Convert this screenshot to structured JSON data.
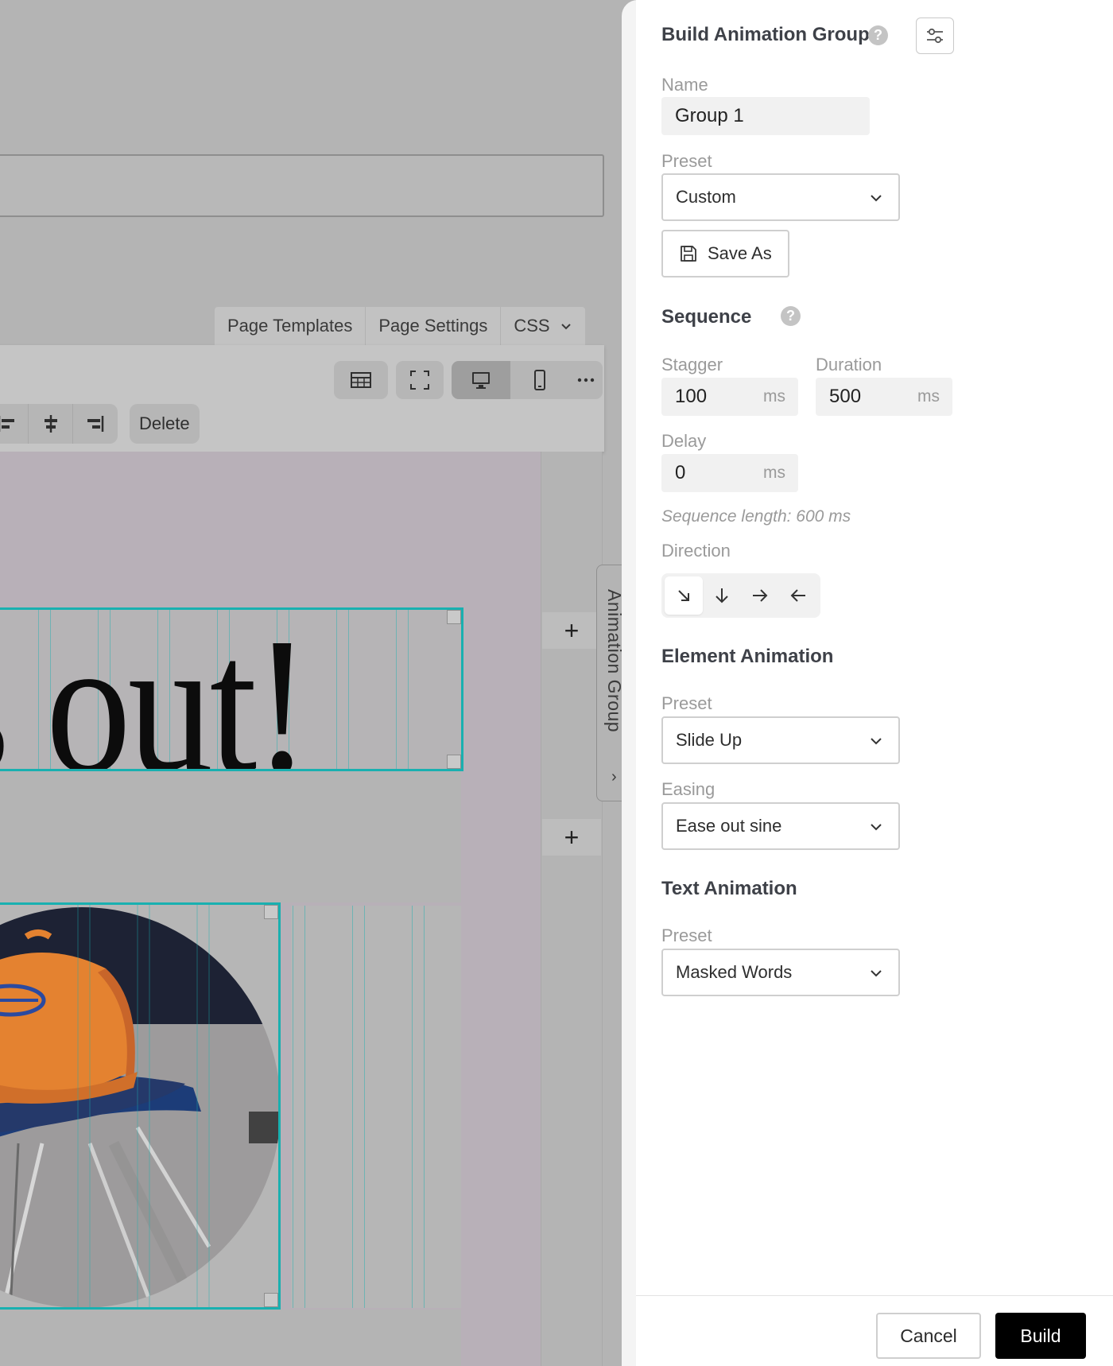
{
  "editor": {
    "tabs": [
      {
        "label": "Page Templates"
      },
      {
        "label": "Page Settings"
      },
      {
        "label": "CSS"
      }
    ],
    "toolbar": {
      "delete_label": "Delete"
    },
    "headline_text": "s out!",
    "side_tab_label": "Animation Group"
  },
  "panel": {
    "title": "Build Animation Group",
    "name": {
      "label": "Name",
      "value": "Group 1"
    },
    "group_preset": {
      "label": "Preset",
      "value": "Custom"
    },
    "save_as_label": "Save As",
    "sequence": {
      "title": "Sequence",
      "stagger": {
        "label": "Stagger",
        "value": "100",
        "unit": "ms"
      },
      "duration": {
        "label": "Duration",
        "value": "500",
        "unit": "ms"
      },
      "delay": {
        "label": "Delay",
        "value": "0",
        "unit": "ms"
      },
      "length_note": "Sequence length: 600 ms",
      "direction": {
        "label": "Direction",
        "options": [
          "diagonal-down-right-arrow-icon",
          "arrow-down-icon",
          "arrow-right-icon",
          "arrow-left-icon"
        ],
        "selected_index": 0
      }
    },
    "element_animation": {
      "title": "Element Animation",
      "preset": {
        "label": "Preset",
        "value": "Slide Up"
      },
      "easing": {
        "label": "Easing",
        "value": "Ease out sine"
      }
    },
    "text_animation": {
      "title": "Text Animation",
      "preset": {
        "label": "Preset",
        "value": "Masked Words"
      }
    },
    "footer": {
      "cancel_label": "Cancel",
      "build_label": "Build"
    }
  },
  "colors": {
    "guide": "#19b0b0",
    "primary_button": "#000000",
    "overlay": "#b4b4b4"
  }
}
